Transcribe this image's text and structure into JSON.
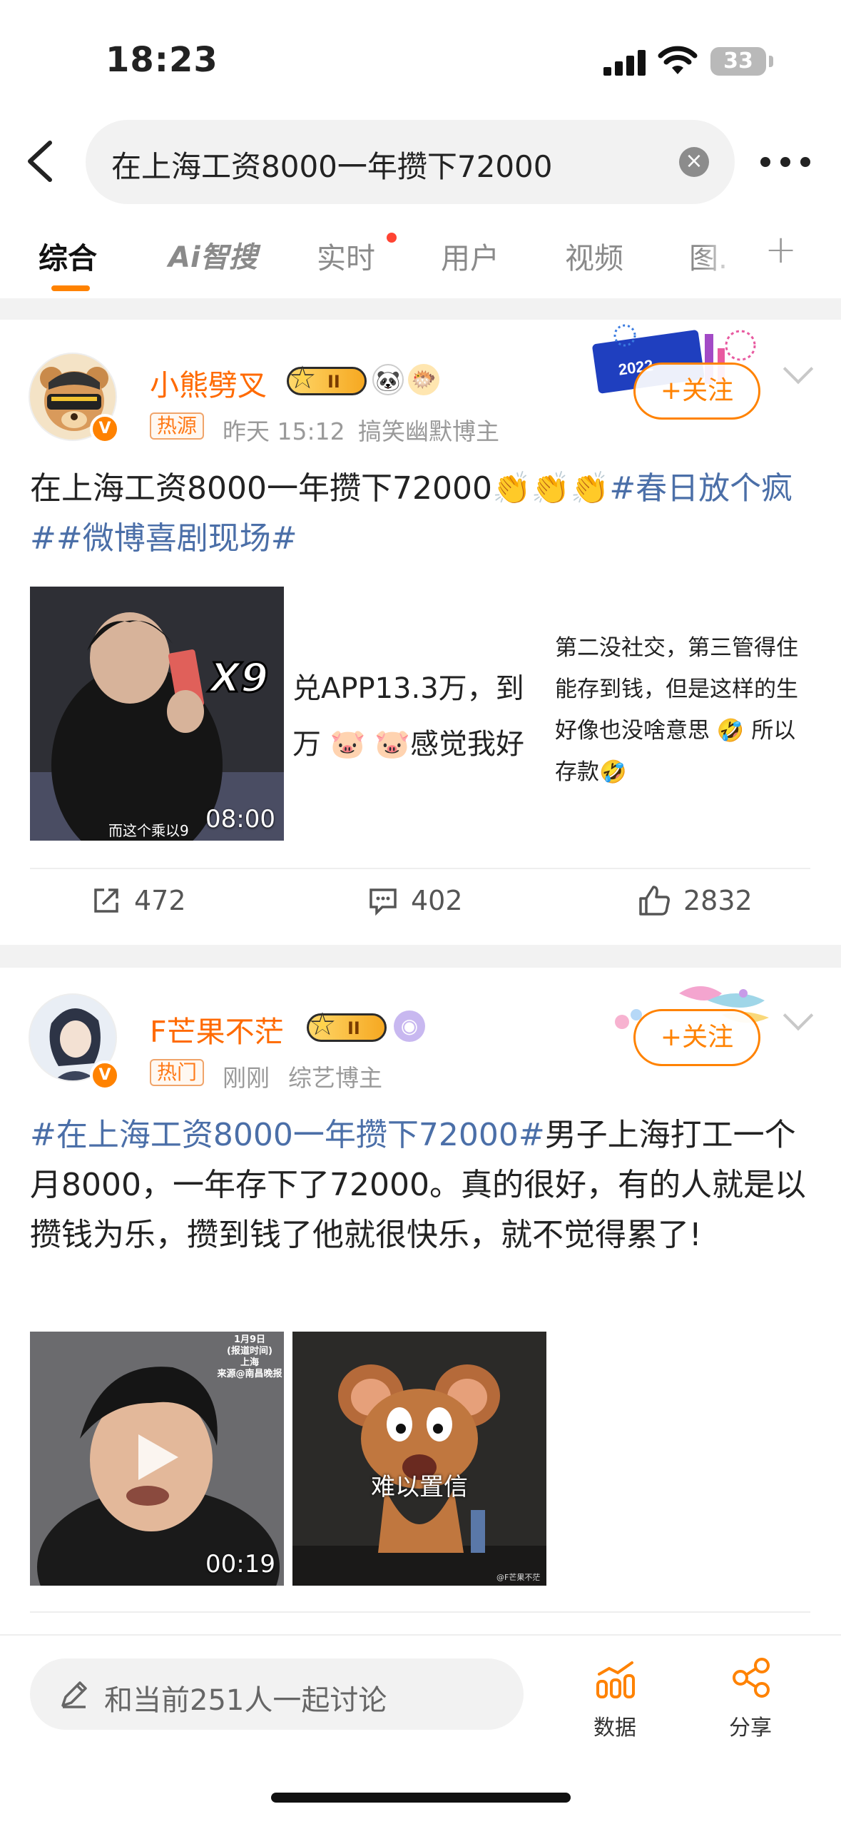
{
  "status_bar": {
    "time": "18:23",
    "battery": "33"
  },
  "search": {
    "query": "在上海工资8000一年攒下72000"
  },
  "tabs": [
    {
      "label": "综合"
    },
    {
      "label": "Ai智搜"
    },
    {
      "label": "实时"
    },
    {
      "label": "用户"
    },
    {
      "label": "视频"
    },
    {
      "label": "图."
    }
  ],
  "posts": [
    {
      "username": "小熊劈叉",
      "level": "II",
      "tag": "热源",
      "time": "昨天 15:12",
      "category": "搞笑幽默博主",
      "follow_label": "+关注",
      "text": "在上海工资8000一年攒下72000",
      "hashtags": "#春日放个疯##微博喜剧现场#",
      "video_overlay": "X9",
      "video_subtitle": "而这个乘以9",
      "duration": "08:00",
      "img2_line1": "兑APP13.3万，到",
      "img2_line2": "万",
      "img2_line2b": "感觉我好",
      "img3_lines": [
        "第二没社交，第三管得住",
        "能存到钱，但是这样的生",
        "好像也没啥意思",
        "所以",
        "存款"
      ],
      "reposts": "472",
      "comments": "402",
      "likes": "2832"
    },
    {
      "username": "F芒果不茫",
      "level": "II",
      "tag": "热门",
      "time": "刚刚",
      "category": "综艺博主",
      "follow_label": "+关注",
      "hashtag": "#在上海工资8000一年攒下72000#",
      "text": "男子上海打工一个月8000，一年存下了72000。真的很好，有的人就是以攒钱为乐，攒到钱了他就很快乐，就不觉得累了!",
      "video_caption": "1月9日\n(报道时间)\n上海\n来源@南昌晚报",
      "duration": "00:19",
      "img2_caption": "难以置信",
      "img2_watermark": "@F芒果不茫"
    }
  ],
  "bottom": {
    "discuss_placeholder": "和当前251人一起讨论",
    "data_label": "数据",
    "share_label": "分享"
  },
  "colors": {
    "accent": "#ff8200",
    "hashtag": "#4b6fa8",
    "username": "#ff6a00"
  }
}
